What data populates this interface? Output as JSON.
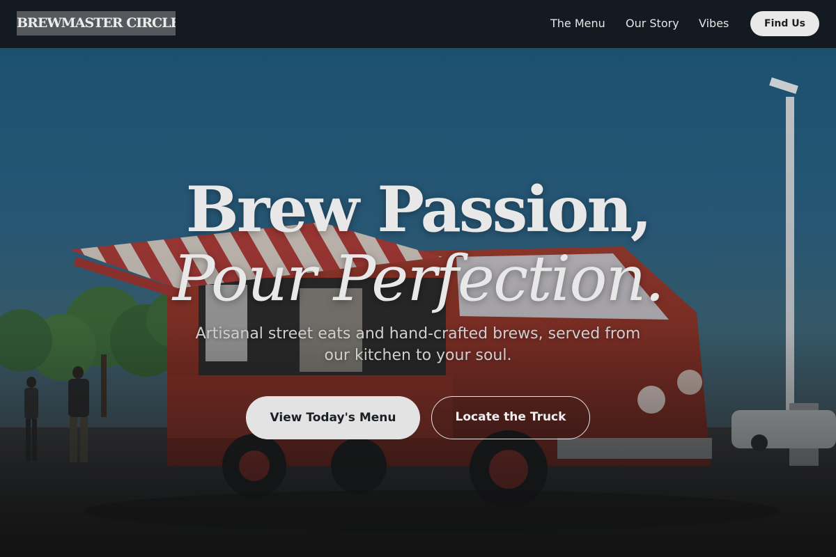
{
  "header": {
    "brand": "BREWMASTER CIRCLE",
    "nav": {
      "menu": "The Menu",
      "story": "Our Story",
      "vibes": "Vibes"
    },
    "cta": "Find Us"
  },
  "hero": {
    "title_line1": "Brew Passion,",
    "title_line2": "Pour Perfection.",
    "subtitle": "Artisanal street eats and hand-crafted brews, served from our kitchen to your soul.",
    "primary_cta": "View Today's Menu",
    "secondary_cta": "Locate the Truck"
  },
  "colors": {
    "header_bg": "#131a21",
    "sky_top": "#1f5678",
    "truck_red": "#8f3327",
    "button_light": "#e3e3e3"
  }
}
